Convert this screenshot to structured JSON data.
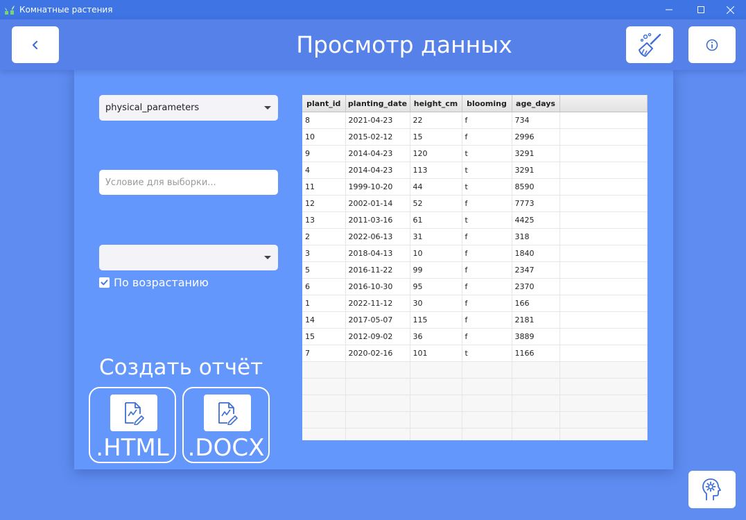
{
  "window": {
    "title": "Комнатные растения"
  },
  "header": {
    "title": "Просмотр данных"
  },
  "filters": {
    "table_select": "physical_parameters",
    "condition_value": "",
    "condition_placeholder": "Условие для выборки...",
    "sort_select": "",
    "ascending_label": "По возрастанию",
    "ascending_checked": true
  },
  "report": {
    "title": "Создать отчёт",
    "html_label": ".HTML",
    "docx_label": ".DOCX"
  },
  "table": {
    "columns": [
      "plant_id",
      "planting_date",
      "height_cm",
      "blooming",
      "age_days"
    ],
    "rows": [
      [
        "8",
        "2021-04-23",
        "22",
        "f",
        "734"
      ],
      [
        "10",
        "2015-02-12",
        "15",
        "f",
        "2996"
      ],
      [
        "9",
        "2014-04-23",
        "120",
        "t",
        "3291"
      ],
      [
        "4",
        "2014-04-23",
        "113",
        "t",
        "3291"
      ],
      [
        "11",
        "1999-10-20",
        "44",
        "t",
        "8590"
      ],
      [
        "12",
        "2002-01-14",
        "52",
        "f",
        "7773"
      ],
      [
        "13",
        "2011-03-16",
        "61",
        "t",
        "4425"
      ],
      [
        "2",
        "2022-06-13",
        "31",
        "f",
        "318"
      ],
      [
        "3",
        "2018-04-13",
        "10",
        "f",
        "1840"
      ],
      [
        "5",
        "2016-11-22",
        "99",
        "f",
        "2347"
      ],
      [
        "6",
        "2016-10-30",
        "95",
        "f",
        "2370"
      ],
      [
        "1",
        "2022-11-12",
        "30",
        "f",
        "166"
      ],
      [
        "14",
        "2017-05-07",
        "115",
        "f",
        "2181"
      ],
      [
        "15",
        "2012-09-02",
        "36",
        "f",
        "3889"
      ],
      [
        "7",
        "2020-02-16",
        "101",
        "t",
        "1166"
      ]
    ]
  },
  "colors": {
    "background": "#5f8cf0",
    "header": "#5581e8",
    "panel": "#6497fb",
    "titlebar": "#3e74e3",
    "icon_accent": "#3d6fd8"
  },
  "icons": {
    "back": "chevron-left-icon",
    "clean": "broom-icon",
    "info": "info-icon",
    "report": "document-chart-icon",
    "settings": "head-gear-icon"
  }
}
